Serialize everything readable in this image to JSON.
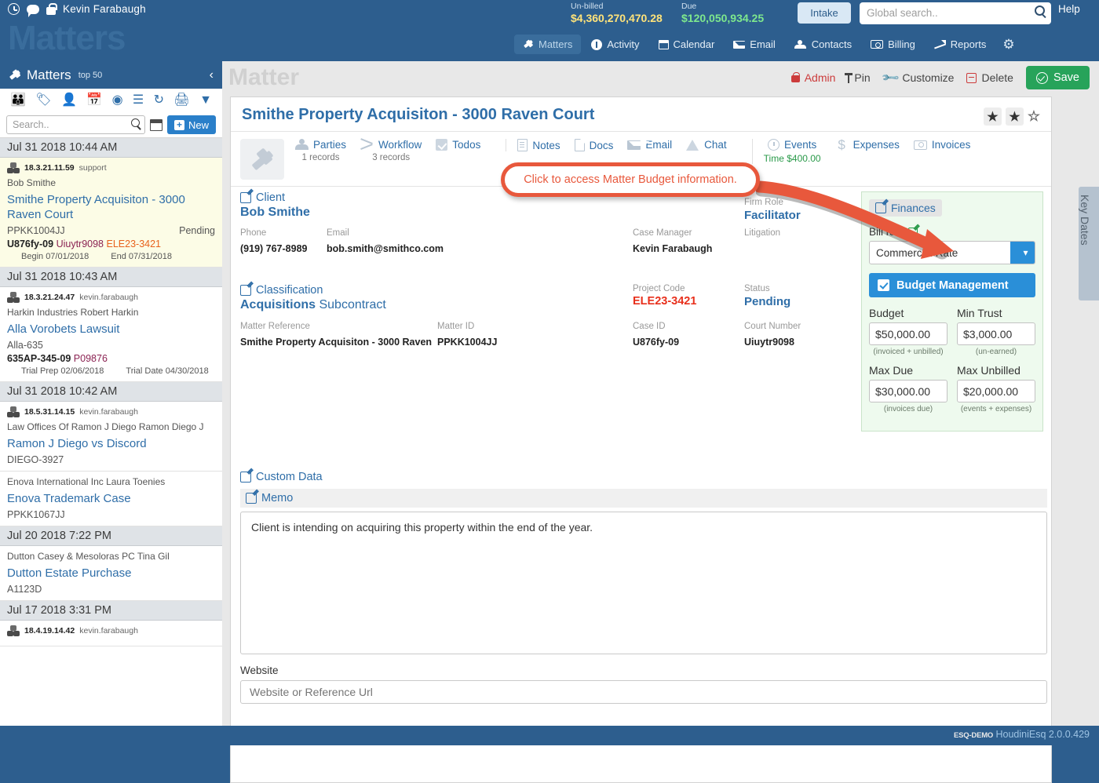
{
  "header": {
    "user_name": "Kevin Farabaugh",
    "clock_icon": "clock-icon",
    "chat_icon": "chat-icon",
    "lock_icon": "lock-icon",
    "watermark": "Matters",
    "stats": [
      {
        "label": "Un-billed",
        "value": "$4,360,270,470.28",
        "color": "#ffe37a"
      },
      {
        "label": "Due",
        "value": "$120,050,934.25",
        "color": "#7ee88d"
      }
    ],
    "intake_label": "Intake",
    "search_placeholder": "Global search..",
    "search_value": "",
    "help_label": "Help",
    "nav": [
      {
        "label": "Matters",
        "icon": "gavel-icon",
        "active": true
      },
      {
        "label": "Activity",
        "icon": "exclamation-icon",
        "active": false
      },
      {
        "label": "Calendar",
        "icon": "calendar-icon",
        "active": false
      },
      {
        "label": "Email",
        "icon": "envelope-icon",
        "active": false
      },
      {
        "label": "Contacts",
        "icon": "people-icon",
        "active": false
      },
      {
        "label": "Billing",
        "icon": "money-icon",
        "active": false
      },
      {
        "label": "Reports",
        "icon": "chart-icon",
        "active": false
      }
    ],
    "gear_label": "⚙"
  },
  "sidebar": {
    "title": "Matters",
    "subtitle": "top 50",
    "collapse_icon": "‹",
    "toolbar_icons": [
      "person-orange-icon",
      "tag-icon",
      "user-icon",
      "calendar-icon",
      "lifebuoy-icon",
      "list-icon",
      "refresh-icon",
      "printer-icon",
      "filter-icon"
    ],
    "search_placeholder": "Search..",
    "search_value": "",
    "calendar_icon": "calendar-icon",
    "new_label": "New",
    "entries": [
      {
        "type": "group",
        "label": "Jul 31 2018 10:44 AM"
      },
      {
        "type": "item",
        "selected": true,
        "ip": "18.3.21.11.59",
        "user": "support",
        "party": "Bob Smithe",
        "matter": "Smithe Property Acquisiton - 3000 Raven Court",
        "code": "PPKK1004JJ",
        "status": "Pending",
        "c1": "U876fy-09",
        "c2": "Uiuytr9098",
        "c3": "ELE23-3421",
        "d1": "Begin 07/01/2018",
        "d2": "End 07/31/2018"
      },
      {
        "type": "group",
        "label": "Jul 31 2018 10:43 AM"
      },
      {
        "type": "item",
        "selected": false,
        "ip": "18.3.21.24.47",
        "user": "kevin.farabaugh",
        "party": "Harkin Industries Robert Harkin",
        "matter": "Alla Vorobets Lawsuit",
        "code": "Alla-635",
        "status": "",
        "c1": "635AP-345-09",
        "c2": "P09876",
        "c3": "",
        "d1": "Trial Prep 02/06/2018",
        "d2": "Trial Date 04/30/2018"
      },
      {
        "type": "group",
        "label": "Jul 31 2018 10:42 AM"
      },
      {
        "type": "item",
        "selected": false,
        "ip": "18.5.31.14.15",
        "user": "kevin.farabaugh",
        "party": "Law Offices Of Ramon J Diego Ramon Diego J",
        "matter": "Ramon J Diego vs Discord",
        "code": "DIEGO-3927",
        "status": "",
        "c1": "",
        "c2": "",
        "c3": "",
        "d1": "",
        "d2": ""
      },
      {
        "type": "item",
        "selected": false,
        "ip": "",
        "user": "",
        "party": "Enova International Inc Laura Toenies",
        "matter": "Enova Trademark Case",
        "code": "PPKK1067JJ",
        "status": "",
        "c1": "",
        "c2": "",
        "c3": "",
        "d1": "",
        "d2": ""
      },
      {
        "type": "group",
        "label": "Jul 20 2018 7:22 PM"
      },
      {
        "type": "item",
        "selected": false,
        "ip": "",
        "user": "",
        "party": "Dutton Casey & Mesoloras PC Tina Gil",
        "matter": "Dutton Estate Purchase",
        "code": "A1123D",
        "status": "",
        "c1": "",
        "c2": "",
        "c3": "",
        "d1": "",
        "d2": ""
      },
      {
        "type": "group",
        "label": "Jul 17 2018 3:31 PM"
      },
      {
        "type": "item",
        "selected": false,
        "ip": "18.4.19.14.42",
        "user": "kevin.farabaugh",
        "party": "",
        "matter": "",
        "code": "",
        "status": "",
        "c1": "",
        "c2": "",
        "c3": "",
        "d1": "",
        "d2": ""
      }
    ]
  },
  "main": {
    "watermark": "Matter",
    "actions": [
      {
        "label": "Admin",
        "icon": "lock-icon"
      },
      {
        "label": "Pin",
        "icon": "pin-icon"
      },
      {
        "label": "Customize",
        "icon": "wrench-icon"
      },
      {
        "label": "Delete",
        "icon": "minus-box-icon"
      }
    ],
    "save_label": "Save",
    "matter_title": "Smithe Property Acquisiton - 3000 Raven Court",
    "stars": [
      "★",
      "★",
      "☆"
    ],
    "tabs": [
      {
        "label": "Parties",
        "sub": "1 records",
        "icon": "people-icon"
      },
      {
        "label": "Workflow",
        "sub": "3 records",
        "icon": "shuffle-icon"
      },
      {
        "label": "Todos",
        "sub": "",
        "icon": "checkbox-icon"
      },
      {
        "label": "Notes",
        "sub": "",
        "icon": "document-icon"
      },
      {
        "label": "Docs",
        "sub": "",
        "icon": "pdf-icon"
      },
      {
        "label": "Email",
        "sub": "",
        "icon": "envelope-icon"
      },
      {
        "label": "Chat",
        "sub": "",
        "icon": "warning-icon"
      },
      {
        "label": "Events",
        "sub": "Time $400.00",
        "icon": "clock-icon"
      },
      {
        "label": "Expenses",
        "sub": "",
        "icon": "dollar-icon"
      },
      {
        "label": "Invoices",
        "sub": "",
        "icon": "invoice-icon"
      }
    ],
    "callout": "Click to access Matter Budget information.",
    "callout_color": "#e8583c",
    "client": {
      "section_label": "Client",
      "name": "Bob Smithe",
      "phone_label": "Phone",
      "phone": "(919) 767-8989",
      "email_label": "Email",
      "email": "bob.smith@smithco.com",
      "firm_role_label": "Firm Role",
      "firm_role": "Facilitator",
      "case_manager_label": "Case Manager",
      "case_manager": "Kevin Farabaugh",
      "litigation_label": "Litigation",
      "litigation": ""
    },
    "classification": {
      "section_label": "Classification",
      "primary": "Acquisitions",
      "secondary": "Subcontract",
      "matter_reference_label": "Matter Reference",
      "matter_reference": "Smithe Property Acquisiton - 3000 Raven",
      "matter_id_label": "Matter ID",
      "matter_id": "PPKK1004JJ",
      "project_code_label": "Project Code",
      "project_code": "ELE23-3421",
      "status_label": "Status",
      "status": "Pending",
      "case_id_label": "Case ID",
      "case_id": "U876fy-09",
      "court_number_label": "Court Number",
      "court_number": "Uiuytr9098"
    },
    "finances": {
      "title": "Finances",
      "bill_rate_label": "Bill rate",
      "bill_rate_value": "Commercial Rate",
      "budget_mgmt_label": "Budget Management",
      "budget_mgmt_checked": true,
      "cells": [
        {
          "label": "Budget",
          "value": "$50,000.00",
          "hint": "(invoiced + unbilled)"
        },
        {
          "label": "Min Trust",
          "value": "$3,000.00",
          "hint": "(un-earned)"
        },
        {
          "label": "Max Due",
          "value": "$30,000.00",
          "hint": "(invoices due)"
        },
        {
          "label": "Max Unbilled",
          "value": "$20,000.00",
          "hint": "(events + expenses)"
        }
      ]
    },
    "custom_data_label": "Custom Data",
    "memo_label": "Memo",
    "memo_text": "Client is intending on acquiring this property within the end of the year.",
    "website_label": "Website",
    "website_placeholder": "Website or Reference Url",
    "website_value": "",
    "key_dates_label": "Key Dates"
  },
  "footer": {
    "demo": "ESQ-DEMO",
    "product": "HoudiniEsq 2.0.0.429"
  }
}
